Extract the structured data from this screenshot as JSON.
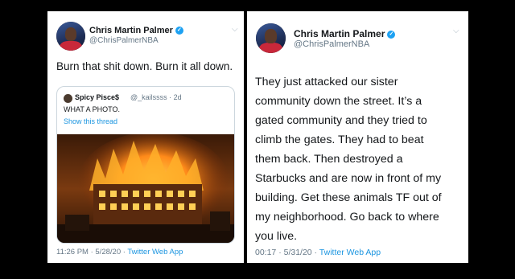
{
  "tweet1": {
    "author": {
      "name": "Chris Martin Palmer",
      "handle": "@ChrisPalmerNBA"
    },
    "text": "Burn that shit down. Burn it all down.",
    "quoted": {
      "author_name": "Spicy Pisce$",
      "meta": "@_kailssss · 2d",
      "text": "WHAT A PHOTO.",
      "show_thread": "Show this thread"
    },
    "timestamp": "11:26 PM · 5/28/20",
    "source": "Twitter Web App"
  },
  "tweet2": {
    "author": {
      "name": "Chris Martin Palmer",
      "handle": "@ChrisPalmerNBA"
    },
    "text": "They just attacked our sister\ncommunity down the street. It’s a\ngated community and they tried to\nclimb the gates. They had to beat\nthem back. Then destroyed a\nStarbucks and are now in front of my\nbuilding. Get these animals TF out of\nmy neighborhood. Go back to where\nyou live.",
    "timestamp": "00:17 · 5/31/20",
    "source": "Twitter Web App"
  },
  "colors": {
    "background": "#000000",
    "card": "#ffffff",
    "link": "#1b95e0",
    "verified": "#1da1f2",
    "muted": "#657786"
  },
  "icons": [
    "verified-badge-icon",
    "chevron-down-icon"
  ],
  "separator": " · "
}
